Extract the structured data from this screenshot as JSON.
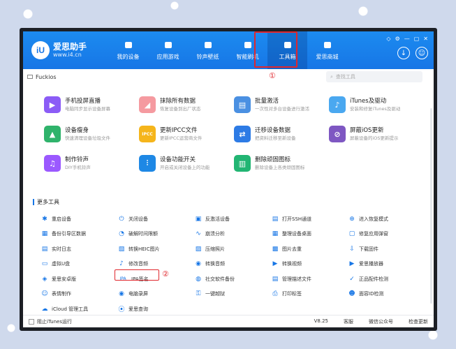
{
  "brand": {
    "logo_letter": "iU",
    "name": "爱思助手",
    "url": "www.i4.cn"
  },
  "nav": [
    {
      "label": "我的设备",
      "icon": "apple-icon"
    },
    {
      "label": "应用游戏",
      "icon": "cube-icon"
    },
    {
      "label": "铃声壁纸",
      "icon": "music-icon"
    },
    {
      "label": "智能刷机",
      "icon": "shield-icon"
    },
    {
      "label": "工具箱",
      "icon": "toolbox-icon",
      "active": true
    },
    {
      "label": "爱思商城",
      "icon": "bag-icon"
    }
  ],
  "annotations": {
    "marker1": "①",
    "marker2": "②"
  },
  "subbar": {
    "device_name": "Fuckios",
    "search_placeholder": "查找工具"
  },
  "tools": [
    {
      "title": "手机投屏直播",
      "desc": "电脑同步显示设备屏幕",
      "icon": "screen-mirror-icon",
      "color": "#8b5cf6",
      "glyph": "▶"
    },
    {
      "title": "抹除所有数据",
      "desc": "恢复设备到出厂状态",
      "icon": "eraser-icon",
      "color": "#f59aa0",
      "glyph": "◢"
    },
    {
      "title": "批量激活",
      "desc": "一次性对多台设备进行激活",
      "icon": "batch-activate-icon",
      "color": "#4a90e2",
      "glyph": "▤"
    },
    {
      "title": "iTunes及驱动",
      "desc": "安装和修复iTunes及驱动",
      "icon": "itunes-icon",
      "color": "#4aa8f0",
      "glyph": "♪"
    },
    {
      "title": "设备瘦身",
      "desc": "快速清理设备垃圾文件",
      "icon": "broom-icon",
      "color": "#2fb36b",
      "glyph": "▲"
    },
    {
      "title": "更新IPCC文件",
      "desc": "更新IPCC运营商文件",
      "icon": "ipcc-icon",
      "color": "#f5b51b",
      "glyph": "IPCC"
    },
    {
      "title": "迁移设备数据",
      "desc": "把资料迁移至新设备",
      "icon": "migrate-icon",
      "color": "#2d7be5",
      "glyph": "⇄"
    },
    {
      "title": "屏蔽iOS更新",
      "desc": "屏蔽设备的iOS更新提示",
      "icon": "block-update-icon",
      "color": "#7e57c2",
      "glyph": "⊘"
    },
    {
      "title": "制作铃声",
      "desc": "DIY手机铃声",
      "icon": "ringtone-icon",
      "color": "#9b59ff",
      "glyph": "♫"
    },
    {
      "title": "设备功能开关",
      "desc": "开启或关闭设备上的功能",
      "icon": "toggle-icon",
      "color": "#1e88e5",
      "glyph": "⫶"
    },
    {
      "title": "删除顽固图标",
      "desc": "删除设备上各类顽固图标",
      "icon": "trash-icon",
      "color": "#22b573",
      "glyph": "▥"
    }
  ],
  "more": {
    "title": "更多工具",
    "items": [
      {
        "label": "重启设备",
        "icon": "restart-icon",
        "glyph": "✱"
      },
      {
        "label": "关闭设备",
        "icon": "power-icon",
        "glyph": "⏻"
      },
      {
        "label": "反激活设备",
        "icon": "deactivate-icon",
        "glyph": "▣"
      },
      {
        "label": "打开SSH通道",
        "icon": "ssh-icon",
        "glyph": "▤"
      },
      {
        "label": "进入恢复模式",
        "icon": "recovery-icon",
        "glyph": "⊕"
      },
      {
        "label": "备份引导区数据",
        "icon": "backup-boot-icon",
        "glyph": "▦"
      },
      {
        "label": "破解时间限额",
        "icon": "time-limit-icon",
        "glyph": "◔"
      },
      {
        "label": "崩溃分析",
        "icon": "crash-icon",
        "glyph": "∿"
      },
      {
        "label": "整理设备桌面",
        "icon": "desktop-icon",
        "glyph": "▦"
      },
      {
        "label": "修复应用弹窗",
        "icon": "fix-popup-icon",
        "glyph": "▢"
      },
      {
        "label": "实时日志",
        "icon": "log-icon",
        "glyph": "▤"
      },
      {
        "label": "转换HEIC图片",
        "icon": "heic-icon",
        "glyph": "▧"
      },
      {
        "label": "压缩照片",
        "icon": "compress-icon",
        "glyph": "▨"
      },
      {
        "label": "图片去重",
        "icon": "dedupe-icon",
        "glyph": "▩"
      },
      {
        "label": "下载固件",
        "icon": "download-firmware-icon",
        "glyph": "⇩"
      },
      {
        "label": "虚拟U盘",
        "icon": "usb-icon",
        "glyph": "▭"
      },
      {
        "label": "修改音频",
        "icon": "edit-audio-icon",
        "glyph": "♪"
      },
      {
        "label": "转换音频",
        "icon": "convert-audio-icon",
        "glyph": "◉"
      },
      {
        "label": "转换视频",
        "icon": "convert-video-icon",
        "glyph": "▶"
      },
      {
        "label": "爱思播放器",
        "icon": "player-icon",
        "glyph": "▶"
      },
      {
        "label": "爱思安卓版",
        "icon": "android-icon",
        "glyph": "◈"
      },
      {
        "label": "IPA签名",
        "icon": "ipa-icon",
        "glyph": "IPA"
      },
      {
        "label": "社交软件备份",
        "icon": "social-backup-icon",
        "glyph": "◍"
      },
      {
        "label": "管理描述文件",
        "icon": "profile-icon",
        "glyph": "▤"
      },
      {
        "label": "正品配件检测",
        "icon": "accessory-check-icon",
        "glyph": "✓"
      },
      {
        "label": "表情制作",
        "icon": "emoji-icon",
        "glyph": "☺"
      },
      {
        "label": "电脑录屏",
        "icon": "record-icon",
        "glyph": "◉"
      },
      {
        "label": "一键越狱",
        "icon": "jailbreak-icon",
        "glyph": "⚿"
      },
      {
        "label": "打印标签",
        "icon": "print-icon",
        "glyph": "⎙"
      },
      {
        "label": "面容ID检测",
        "icon": "faceid-icon",
        "glyph": "☻"
      },
      {
        "label": "iCloud 管理工具",
        "icon": "icloud-icon",
        "glyph": "☁"
      },
      {
        "label": "爱思查询",
        "icon": "query-icon",
        "glyph": "⦿"
      }
    ]
  },
  "footer": {
    "block_itunes": "阻止iTunes运行",
    "version": "V8.25",
    "feedback": "客服",
    "wechat": "微信公众号",
    "check_update": "检查更新"
  }
}
